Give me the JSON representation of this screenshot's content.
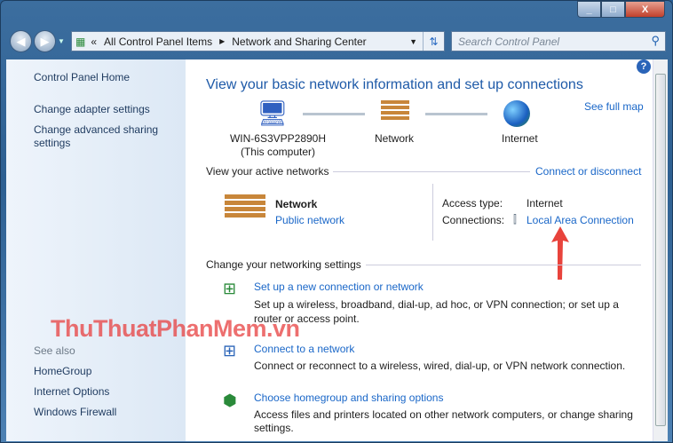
{
  "window": {
    "min": "_",
    "max": "□",
    "close": "X"
  },
  "address": {
    "crumbs": [
      "All Control Panel Items",
      "Network and Sharing Center"
    ]
  },
  "search": {
    "placeholder": "Search Control Panel"
  },
  "sidebar": {
    "home": "Control Panel Home",
    "items": [
      "Change adapter settings",
      "Change advanced sharing settings"
    ],
    "see_also": "See also",
    "see_also_items": [
      "HomeGroup",
      "Internet Options",
      "Windows Firewall"
    ]
  },
  "main": {
    "title": "View your basic network information and set up connections",
    "see_full_map": "See full map",
    "map": {
      "computer": "WIN-6S3VPP2890H",
      "computer_sub": "(This computer)",
      "network": "Network",
      "internet": "Internet"
    },
    "active_header": "View your active networks",
    "connect_link": "Connect or disconnect",
    "network_name": "Network",
    "network_type": "Public network",
    "access_label": "Access type:",
    "access_value": "Internet",
    "conn_label": "Connections:",
    "conn_value": "Local Area Connection",
    "change_header": "Change your networking settings",
    "tasks": [
      {
        "link": "Set up a new connection or network",
        "desc": "Set up a wireless, broadband, dial-up, ad hoc, or VPN connection; or set up a router or access point."
      },
      {
        "link": "Connect to a network",
        "desc": "Connect or reconnect to a wireless, wired, dial-up, or VPN network connection."
      },
      {
        "link": "Choose homegroup and sharing options",
        "desc": "Access files and printers located on other network computers, or change sharing settings."
      }
    ]
  },
  "watermark": "ThuThuatPhanMem.vn",
  "colors": {
    "link": "#1a67c8",
    "title": "#1e5aa8",
    "arrow": "#e8433c"
  }
}
